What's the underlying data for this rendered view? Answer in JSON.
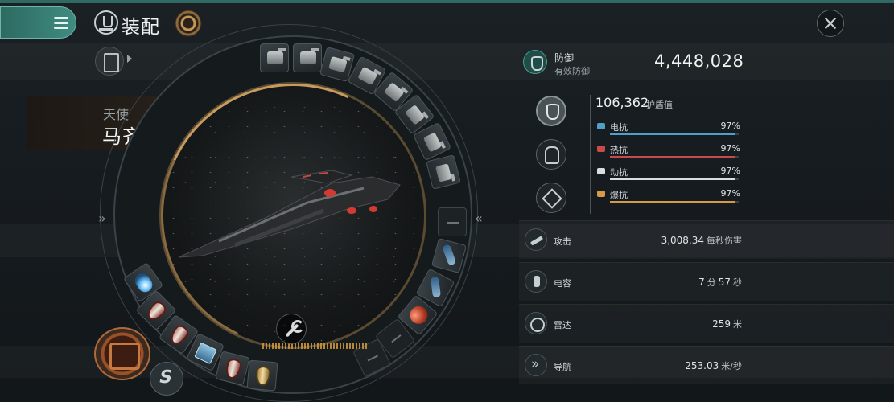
{
  "header": {
    "menu_icon": "hamburger-menu-icon",
    "title": "装配",
    "close_icon": "close-icon"
  },
  "ship": {
    "class_label": "天使",
    "name": "马齐奥级",
    "name_chevron": "»"
  },
  "ring": {
    "left_chevron": "»",
    "right_chevron": "«",
    "high_slots": [
      "turret",
      "turret",
      "turret",
      "turret",
      "turret",
      "turret",
      "turret",
      "turret"
    ],
    "mid_slots": [
      "empty",
      "cannon",
      "cannon",
      "orb",
      "empty",
      "empty"
    ],
    "low_slots": [
      "blueball",
      "shield",
      "shield",
      "cube",
      "shield",
      "gold-shield"
    ]
  },
  "defense": {
    "title": "防御",
    "subtitle": "有效防御",
    "value": "4,448,028"
  },
  "shield": {
    "value": "106,362",
    "unit": "护盾值",
    "resists": [
      {
        "label": "电抗",
        "pct": "97%",
        "color": "#4f9fc8",
        "fill": 0.97
      },
      {
        "label": "热抗",
        "pct": "97%",
        "color": "#c84a4a",
        "fill": 0.97
      },
      {
        "label": "动抗",
        "pct": "97%",
        "color": "#d9dde0",
        "fill": 0.97
      },
      {
        "label": "爆抗",
        "pct": "97%",
        "color": "#d69a46",
        "fill": 0.97
      }
    ]
  },
  "stats": {
    "attack": {
      "label": "攻击",
      "value": "3,008.34",
      "unit": "每秒伤害"
    },
    "capacitor": {
      "label": "电容",
      "min": "7",
      "min_unit": "分",
      "sec": "57",
      "sec_unit": "秒"
    },
    "radar": {
      "label": "雷达",
      "value": "259",
      "unit": "米"
    },
    "navigation": {
      "label": "导航",
      "value": "253.03",
      "unit": "米/秒"
    }
  }
}
